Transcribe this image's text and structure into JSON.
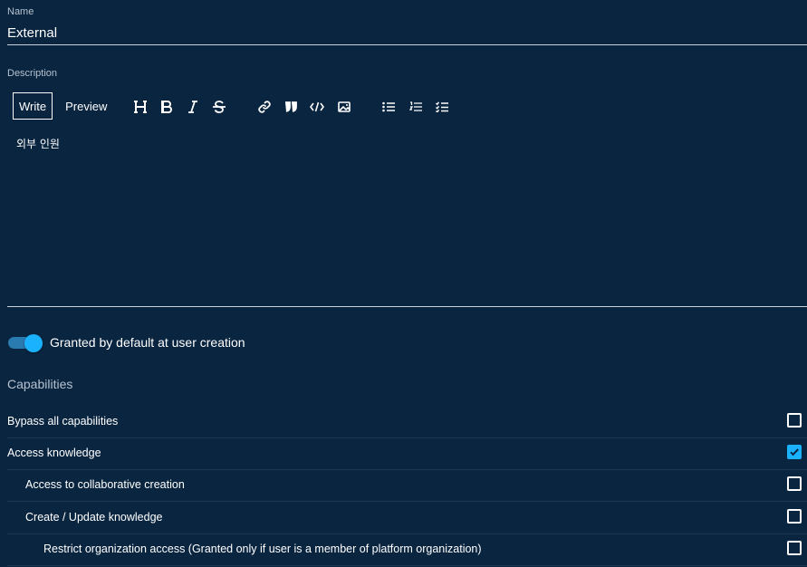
{
  "name_field": {
    "label": "Name",
    "value": "External"
  },
  "description_field": {
    "label": "Description",
    "tabs": {
      "write": "Write",
      "preview": "Preview"
    },
    "toolbar_icons": [
      "heading-icon",
      "bold-icon",
      "italic-icon",
      "strikethrough-icon",
      "link-icon",
      "quote-icon",
      "code-icon",
      "image-icon",
      "bulleted-list-icon",
      "numbered-list-icon",
      "checklist-icon"
    ],
    "value": "외부 인원"
  },
  "default_toggle": {
    "label": "Granted by default at user creation",
    "on": true
  },
  "capabilities": {
    "title": "Capabilities",
    "items": [
      {
        "label": "Bypass all capabilities",
        "level": 0,
        "checked": false
      },
      {
        "label": "Access knowledge",
        "level": 0,
        "checked": true
      },
      {
        "label": "Access to collaborative creation",
        "level": 1,
        "checked": false
      },
      {
        "label": "Create / Update knowledge",
        "level": 1,
        "checked": false
      },
      {
        "label": "Restrict organization access (Granted only if user is a member of platform organization)",
        "level": 2,
        "checked": false
      }
    ]
  },
  "colors": {
    "background": "#0a2540",
    "accent": "#1ab2ff",
    "toggle_track": "#2a7bb0"
  }
}
